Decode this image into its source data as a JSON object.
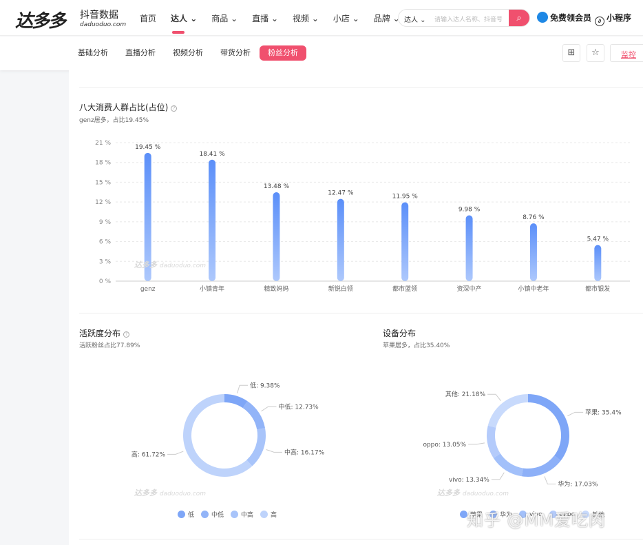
{
  "header": {
    "logo": "达多多",
    "logo_sub": "抖音数据",
    "logo_url": "daduoduo.com",
    "nav": [
      {
        "label": "首页"
      },
      {
        "label": "达人 ⌄",
        "active": true
      },
      {
        "label": "商品 ⌄"
      },
      {
        "label": "直播 ⌄"
      },
      {
        "label": "视频 ⌄"
      },
      {
        "label": "小店 ⌄"
      },
      {
        "label": "品牌 ⌄"
      }
    ],
    "search_type": "达人 ⌄",
    "search_placeholder": "请输入达人名称、抖音号",
    "vip": "免费领会员",
    "mini": "小程序"
  },
  "subnav": {
    "tabs": [
      {
        "label": "基础分析"
      },
      {
        "label": "直播分析"
      },
      {
        "label": "视频分析"
      },
      {
        "label": "带货分析"
      },
      {
        "label": "粉丝分析",
        "active": true
      }
    ],
    "monitor": "监控"
  },
  "watermark": "达多多",
  "watermark_url": "daduoduo.com",
  "overlay_watermark": "知乎 @MM爱吃肉",
  "chart_data": [
    {
      "type": "bar",
      "title": "八大消费人群占比(占位)",
      "subtitle": "genz居多，占比19.45%",
      "categories": [
        "genz",
        "小镇青年",
        "精致妈妈",
        "新锐白领",
        "都市蓝领",
        "资深中产",
        "小镇中老年",
        "都市银发"
      ],
      "values": [
        19.45,
        18.41,
        13.48,
        12.47,
        11.95,
        9.98,
        8.76,
        5.47
      ],
      "labels": [
        "19.45 %",
        "18.41 %",
        "13.48 %",
        "12.47 %",
        "11.95 %",
        "9.98 %",
        "8.76 %",
        "5.47 %"
      ],
      "yticks": [
        "0 %",
        "3 %",
        "6 %",
        "9 %",
        "12 %",
        "15 %",
        "18 %",
        "21 %"
      ],
      "ylim": [
        0,
        21
      ],
      "grid": true
    },
    {
      "type": "pie",
      "title": "活跃度分布",
      "subtitle": "活跃粉丝占比77.89%",
      "slices": [
        {
          "name": "低",
          "value": 9.38,
          "label": "低: 9.38%",
          "color": "#7ea6f7"
        },
        {
          "name": "中低",
          "value": 12.73,
          "label": "中低: 12.73%",
          "color": "#92b4f8"
        },
        {
          "name": "中高",
          "value": 16.17,
          "label": "中高: 16.17%",
          "color": "#a8c4fa"
        },
        {
          "name": "高",
          "value": 61.72,
          "label": "高: 61.72%",
          "color": "#bed3fb"
        }
      ],
      "legend": "bottom"
    },
    {
      "type": "pie",
      "title": "设备分布",
      "subtitle": "苹果居多，占比35.40%",
      "slices": [
        {
          "name": "苹果",
          "value": 35.4,
          "label": "苹果: 35.4%",
          "color": "#7ea6f7"
        },
        {
          "name": "华为",
          "value": 17.03,
          "label": "华为: 17.03%",
          "color": "#8db0f8"
        },
        {
          "name": "vivo",
          "value": 13.34,
          "label": "vivo: 13.34%",
          "color": "#a2c0fa"
        },
        {
          "name": "oppo",
          "value": 13.05,
          "label": "oppo: 13.05%",
          "color": "#b4cbfb"
        },
        {
          "name": "其他",
          "value": 21.18,
          "label": "其他: 21.18%",
          "color": "#c8dafc"
        }
      ],
      "legend": "bottom"
    }
  ]
}
